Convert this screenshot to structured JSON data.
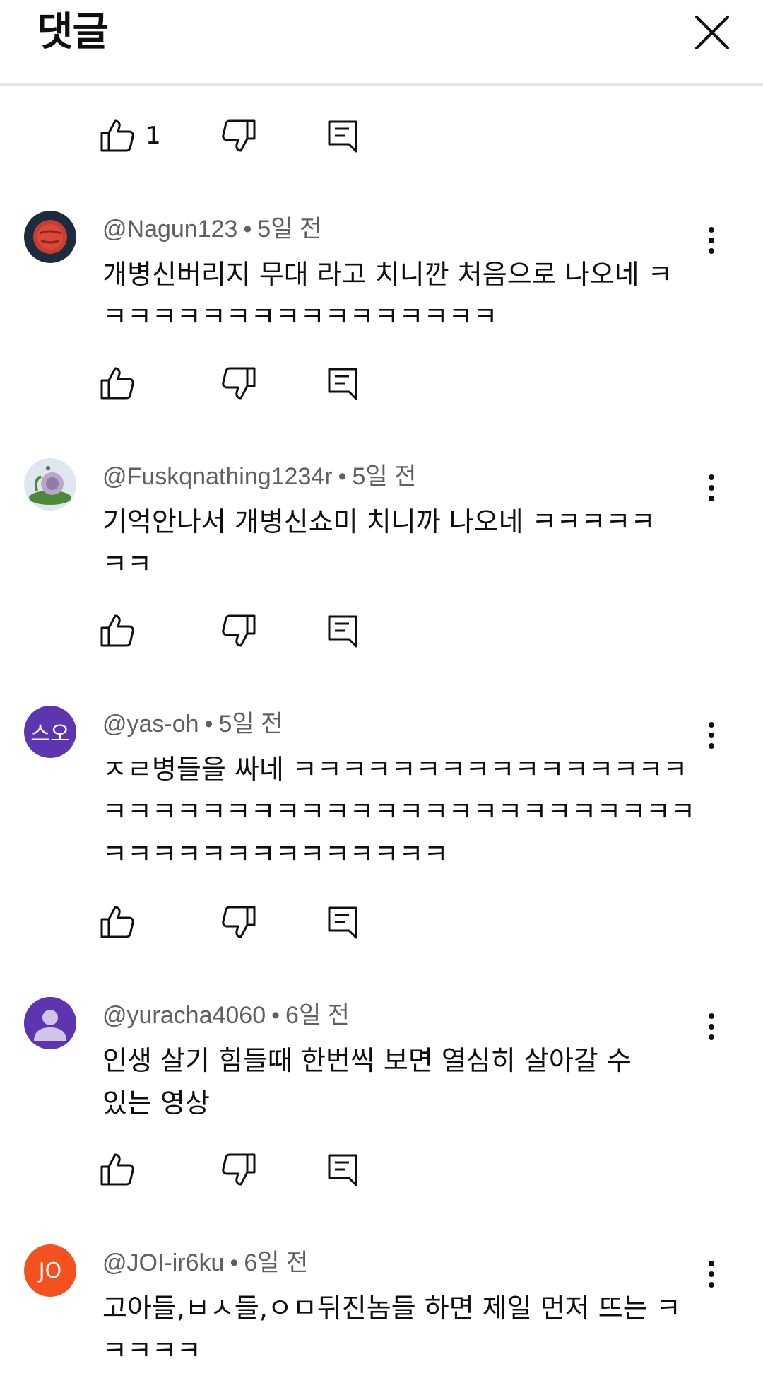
{
  "header": {
    "title": "댓글"
  },
  "top_actions": {
    "like_count": "1"
  },
  "comments": [
    {
      "author": "@Nagun123",
      "time": "5일 전",
      "lines": [
        "개병신버리지 무대 라고 치니깐 처음으로 나오네 ㅋ",
        "ㅋㅋㅋㅋㅋㅋㅋㅋㅋㅋㅋㅋㅋㅋㅋㅋ"
      ],
      "avatar": {
        "type": "image",
        "icon": "red-planet-avatar",
        "bg": "#1c2c3c",
        "color": "#d9483b"
      }
    },
    {
      "author": "@Fuskqnathing1234r",
      "time": "5일 전",
      "lines": [
        "기억안나서 개병신쇼미 치니까 나오네 ㅋㅋㅋㅋㅋ",
        "ㅋㅋ"
      ],
      "avatar": {
        "type": "image",
        "icon": "snail-avatar",
        "bg": "#dfe6ef",
        "color": "#4a8a3a"
      }
    },
    {
      "author": "@yas-oh",
      "time": "5일 전",
      "lines": [
        "ㅈㄹ병들을 싸네 ㅋㅋㅋㅋㅋㅋㅋㅋㅋㅋㅋㅋㅋㅋㅋㅋ",
        "ㅋㅋㅋㅋㅋㅋㅋㅋㅋㅋㅋㅋㅋㅋㅋㅋㅋㅋㅋㅋㅋㅋㅋㅋ",
        "ㅋㅋㅋㅋㅋㅋㅋㅋㅋㅋㅋㅋㅋㅋ"
      ],
      "avatar": {
        "type": "initials",
        "text": "스오",
        "bg": "#5e35b1"
      }
    },
    {
      "author": "@yuracha4060",
      "time": "6일 전",
      "lines": [
        "인생 살기 힘들때 한번씩 보면 열심히 살아갈 수",
        "있는 영상"
      ],
      "avatar": {
        "type": "default",
        "icon": "person-avatar",
        "bg": "#5e35b1"
      }
    },
    {
      "author": "@JOI-ir6ku",
      "time": "6일 전",
      "lines": [
        "고아들,ㅂㅅ들,ㅇㅁ뒤진놈들 하면 제일 먼저 뜨는 ㅋ",
        "ㅋㅋㅋㅋ"
      ],
      "avatar": {
        "type": "initials",
        "text": "JO",
        "bg": "#f4511e"
      }
    }
  ]
}
